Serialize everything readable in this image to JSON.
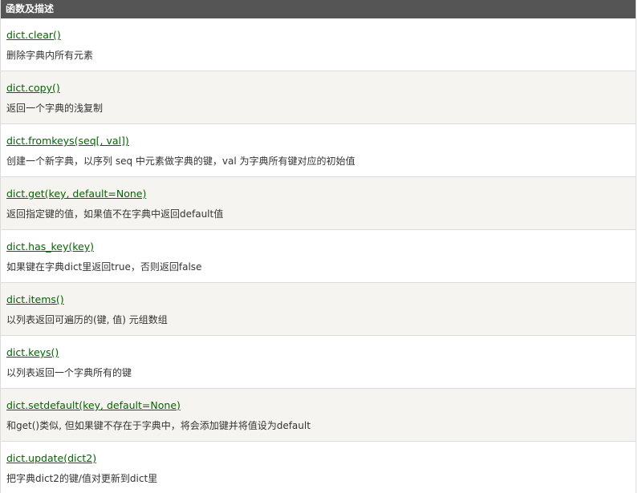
{
  "table": {
    "header": "函数及描述",
    "rows": [
      {
        "func": "dict.clear()",
        "desc": "删除字典内所有元素"
      },
      {
        "func": "dict.copy()",
        "desc": "返回一个字典的浅复制"
      },
      {
        "func": "dict.fromkeys(seq[, val])",
        "desc": "创建一个新字典，以序列 seq 中元素做字典的键，val 为字典所有键对应的初始值"
      },
      {
        "func": "dict.get(key, default=None)",
        "desc": "返回指定键的值，如果值不在字典中返回default值"
      },
      {
        "func": "dict.has_key(key)",
        "desc": "如果键在字典dict里返回true，否则返回false"
      },
      {
        "func": "dict.items()",
        "desc": "以列表返回可遍历的(键, 值) 元组数组"
      },
      {
        "func": "dict.keys()",
        "desc": "以列表返回一个字典所有的键"
      },
      {
        "func": "dict.setdefault(key, default=None)",
        "desc": "和get()类似, 但如果键不存在于字典中，将会添加键并将值设为default"
      },
      {
        "func": "dict.update(dict2)",
        "desc": "把字典dict2的键/值对更新到dict里"
      }
    ]
  },
  "colors": {
    "header_bg": "#555555",
    "link": "#006600",
    "alt_row": "#f6f4f0"
  }
}
